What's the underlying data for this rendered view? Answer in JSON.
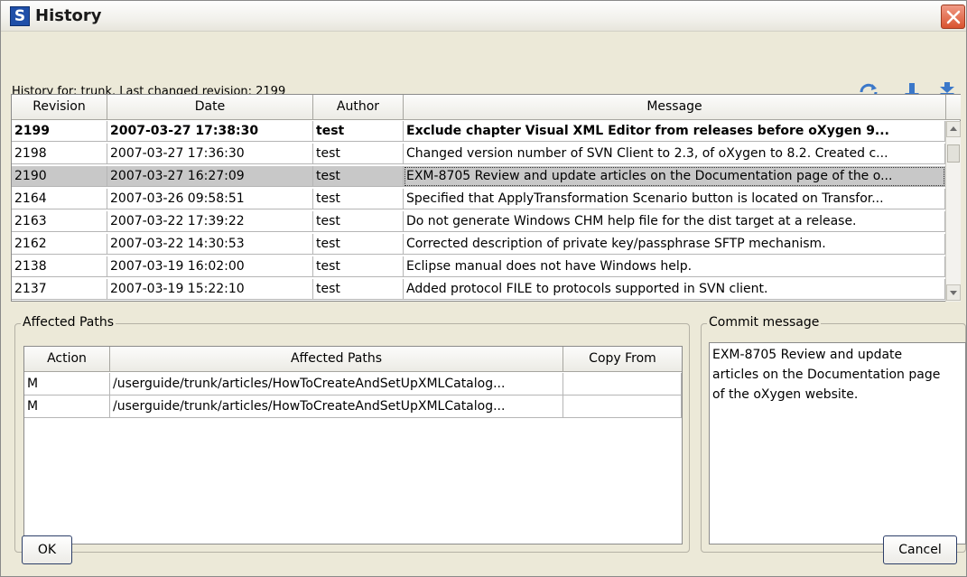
{
  "window": {
    "title": "History",
    "app_icon_letter": "S"
  },
  "info": {
    "history_for": "History for: trunk. Last changed revision: 2199"
  },
  "toolbar": {
    "refresh_icon": "refresh-icon",
    "next_icon": "arrow-down-icon",
    "last_icon": "double-arrow-down-icon"
  },
  "revisions": {
    "columns": [
      "Revision",
      "Date",
      "Author",
      "Message"
    ],
    "rows": [
      {
        "revision": "2199",
        "date": "2007-03-27 17:38:30",
        "author": "test",
        "message": "Exclude chapter Visual XML Editor from releases before oXygen 9...",
        "bold": true
      },
      {
        "revision": "2198",
        "date": "2007-03-27 17:36:30",
        "author": "test",
        "message": "Changed version number of SVN Client to 2.3, of oXygen to 8.2. Created c..."
      },
      {
        "revision": "2190",
        "date": "2007-03-27 16:27:09",
        "author": "test",
        "message": "EXM-8705 Review and update articles on the Documentation page of the o...",
        "selected": true
      },
      {
        "revision": "2164",
        "date": "2007-03-26 09:58:51",
        "author": "test",
        "message": "Specified that ApplyTransformation Scenario button is located on Transfor..."
      },
      {
        "revision": "2163",
        "date": "2007-03-22 17:39:22",
        "author": "test",
        "message": "Do not generate Windows CHM help file for the dist target at a release."
      },
      {
        "revision": "2162",
        "date": "2007-03-22 14:30:53",
        "author": "test",
        "message": "Corrected description of private key/passphrase SFTP mechanism."
      },
      {
        "revision": "2138",
        "date": "2007-03-19 16:02:00",
        "author": "test",
        "message": "Eclipse manual does not have Windows help."
      },
      {
        "revision": "2137",
        "date": "2007-03-19 15:22:10",
        "author": "test",
        "message": "Added protocol FILE to protocols supported in SVN client."
      }
    ]
  },
  "affected_paths": {
    "group_label": "Affected Paths",
    "columns": [
      "Action",
      "Affected Paths",
      "Copy From"
    ],
    "rows": [
      {
        "action": "M",
        "path": "/userguide/trunk/articles/HowToCreateAndSetUpXMLCatalog...",
        "copy_from": ""
      },
      {
        "action": "M",
        "path": "/userguide/trunk/articles/HowToCreateAndSetUpXMLCatalog...",
        "copy_from": ""
      }
    ]
  },
  "commit": {
    "group_label": "Commit message",
    "lines": [
      "EXM-8705 Review and update",
      "articles on the Documentation page",
      "of the oXygen website."
    ]
  },
  "buttons": {
    "ok": "OK",
    "cancel": "Cancel"
  }
}
